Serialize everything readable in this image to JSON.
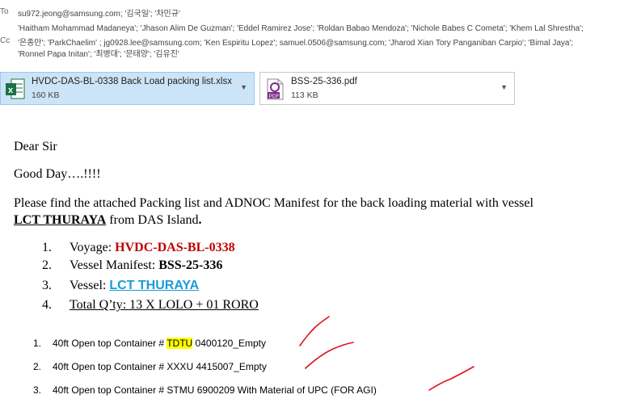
{
  "header": {
    "to_label": "To",
    "cc_label": "Cc",
    "to_line": "su972.jeong@samsung.com; '김국일'; '차민규'",
    "cc_line1": "'Haitham Mohammad Madaneya'; 'Jhason Alim De Guzman'; 'Eddel Ramirez Jose'; 'Roldan Babao Mendoza'; 'Nichole Babes C Cometa'; 'Khem Lal Shrestha';",
    "cc_line2": "'은종만'; 'ParkChaelim'   ; jg0928.lee@samsung.com; 'Ken Espiritu Lopez'; samuel.0506@samsung.com; 'Jharod Xian Tory Panganiban Carpio'; 'Bimal Jaya';",
    "cc_line3": "'Ronnel Papa Initan'; '최병대'; '문태양'; '김유진'"
  },
  "attachments": [
    {
      "name": "HVDC-DAS-BL-0338 Back Load packing list.xlsx",
      "size": "160 KB",
      "icon": "excel-icon"
    },
    {
      "name": "BSS-25-336.pdf",
      "size": "113 KB",
      "icon": "pdf-icon"
    }
  ],
  "body": {
    "greeting": "Dear Sir",
    "good_day": "Good Day….!!!!",
    "intro_line1": "Please find the attached Packing list and ADNOC Manifest for the back loading material with vessel",
    "vessel_bold": "LCT THURAYA",
    "from_text": " from DAS Island",
    "period": ".",
    "list": [
      {
        "num": "1.",
        "label": "Voyage: ",
        "value": "HVDC-DAS-BL-0338"
      },
      {
        "num": "2.",
        "label": "Vessel Manifest: ",
        "value": "BSS-25-336"
      },
      {
        "num": "3.",
        "label": "Vessel: ",
        "value": "LCT THURAYA"
      },
      {
        "num": "4.",
        "label": "Total Q’ty: 13 X LOLO + 01 RORO",
        "value": ""
      }
    ],
    "containers": [
      {
        "num": "1.",
        "prefix": "40ft Open top Container # ",
        "highlight": "TDTU",
        "suffix": " 0400120_Empty"
      },
      {
        "num": "2.",
        "prefix": "40ft Open top Container # XXXU 4415007_Empty",
        "highlight": "",
        "suffix": ""
      },
      {
        "num": "3.",
        "prefix": "40ft Open top Container # STMU 6900209 With Material of UPC (FOR AGI)",
        "highlight": "",
        "suffix": ""
      }
    ]
  },
  "colors": {
    "voyage": "#c00000",
    "vessel_link": "#1a9bd7",
    "ink": "#e0101e",
    "selected_attachment": "#cce4f7"
  }
}
